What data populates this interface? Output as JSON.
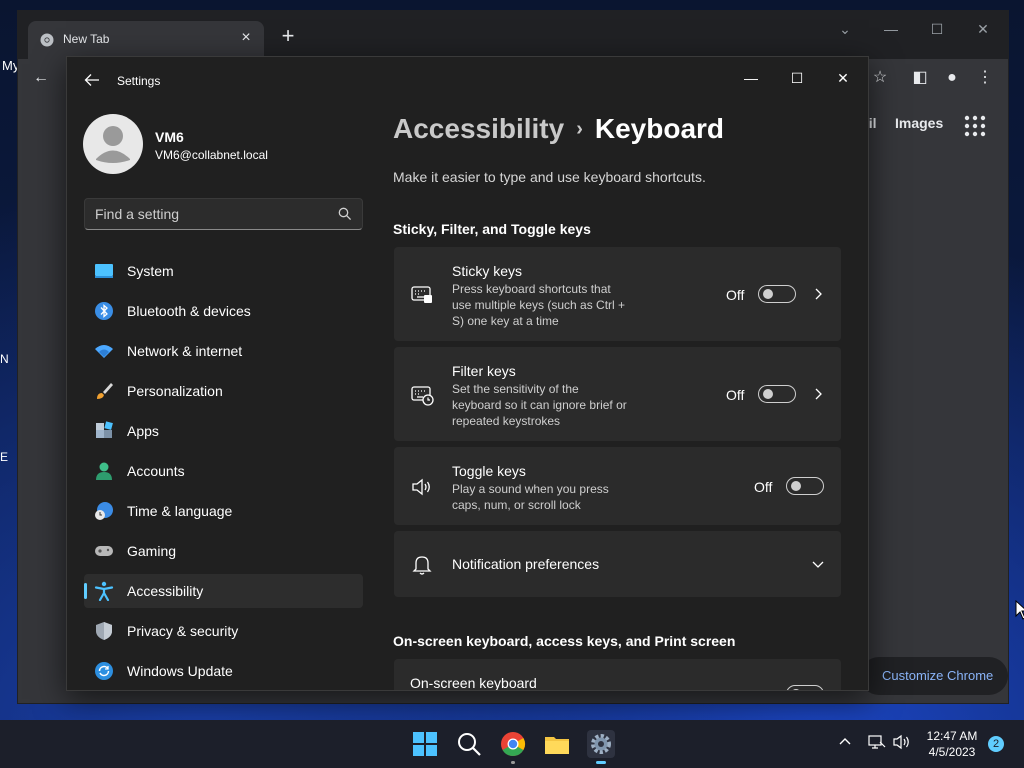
{
  "desktop": {
    "left_labels": [
      "My",
      "N",
      "E"
    ]
  },
  "chrome": {
    "tab_title": "New Tab",
    "close_tab": "×",
    "new_tab": "+",
    "links": {
      "mail": "ail",
      "images": "Images"
    },
    "customize_label": "Customize Chrome"
  },
  "settings": {
    "app_title": "Settings",
    "profile": {
      "name": "VM6",
      "email": "VM6@collabnet.local"
    },
    "search_placeholder": "Find a setting",
    "nav": [
      {
        "label": "System",
        "icon": "system-icon"
      },
      {
        "label": "Bluetooth & devices",
        "icon": "bluetooth-icon"
      },
      {
        "label": "Network & internet",
        "icon": "wifi-icon"
      },
      {
        "label": "Personalization",
        "icon": "brush-icon"
      },
      {
        "label": "Apps",
        "icon": "apps-icon"
      },
      {
        "label": "Accounts",
        "icon": "person-icon"
      },
      {
        "label": "Time & language",
        "icon": "clock-globe-icon"
      },
      {
        "label": "Gaming",
        "icon": "gamepad-icon"
      },
      {
        "label": "Accessibility",
        "icon": "accessibility-icon",
        "active": true
      },
      {
        "label": "Privacy & security",
        "icon": "shield-icon"
      },
      {
        "label": "Windows Update",
        "icon": "update-icon"
      }
    ],
    "breadcrumb": {
      "parent": "Accessibility",
      "separator": "›",
      "current": "Keyboard"
    },
    "description": "Make it easier to type and use keyboard shortcuts.",
    "section1": "Sticky, Filter, and Toggle keys",
    "cards": [
      {
        "title": "Sticky keys",
        "desc": "Press keyboard shortcuts that use multiple keys (such as Ctrl + S) one key at a time",
        "state": "Off",
        "icon": "keyboard-sticky-icon"
      },
      {
        "title": "Filter keys",
        "desc": "Set the sensitivity of the keyboard so it can ignore brief or repeated keystrokes",
        "state": "Off",
        "icon": "keyboard-filter-icon"
      },
      {
        "title": "Toggle keys",
        "desc": "Play a sound when you press caps, num, or scroll lock",
        "state": "Off",
        "icon": "speaker-icon"
      },
      {
        "title": "Notification preferences",
        "icon": "bell-icon"
      }
    ],
    "section2": "On-screen keyboard, access keys, and Print screen",
    "osk_title": "On-screen keyboard"
  },
  "taskbar": {
    "time": "12:47 AM",
    "date": "4/5/2023",
    "notification_count": "2"
  },
  "colors": {
    "accent": "#60cdff",
    "settings_bg": "#202020",
    "card_bg": "#2b2b2b",
    "chrome_bg": "#35363a"
  }
}
